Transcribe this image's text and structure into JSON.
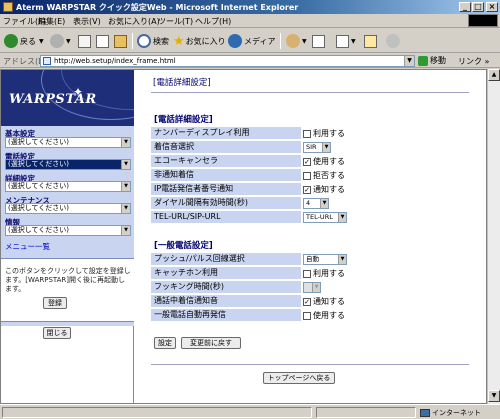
{
  "window": {
    "title": "Aterm WARPSTAR クイック設定Web - Microsoft Internet Explorer"
  },
  "menubar": {
    "items": [
      "ファイル(F)",
      "編集(E)",
      "表示(V)",
      "お気に入り(A)",
      "ツール(T)",
      "ヘルプ(H)"
    ]
  },
  "toolbar": {
    "back_label": "戻る",
    "search_label": "検索",
    "favorites_label": "お気に入り",
    "media_label": "メディア"
  },
  "addressbar": {
    "label": "アドレス(D)",
    "url": "http://web.setup/index_frame.html",
    "go_label": "移動",
    "links_label": "リンク »"
  },
  "sidebar": {
    "logo_text": "WARPSTAR",
    "sections": [
      {
        "label": "基本設定",
        "value": "(選択してください)"
      },
      {
        "label": "電話設定",
        "value": "(選択してください)"
      },
      {
        "label": "詳細設定",
        "value": "(選択してください)"
      },
      {
        "label": "メンテナンス",
        "value": "(選択してください)"
      },
      {
        "label": "情報",
        "value": "(選択してください)"
      }
    ],
    "menu_list_label": "メニュー一覧",
    "save_note": "このボタンをクリックして設定を登録します。[WARPSTAR]開く後に再起動します。",
    "register_button": "登録",
    "close_button": "閉じる"
  },
  "main": {
    "page_title": "[電話詳細設定]",
    "section1_title": "[電話詳細設定]",
    "section1_rows": [
      {
        "label": "ナンバーディスプレイ利用",
        "type": "checkbox",
        "checked": false,
        "value": "利用する"
      },
      {
        "label": "着信音選択",
        "type": "select",
        "value": "SIR"
      },
      {
        "label": "エコーキャンセラ",
        "type": "checkbox",
        "checked": true,
        "value": "使用する"
      },
      {
        "label": "非通知着信",
        "type": "checkbox",
        "checked": false,
        "value": "拒否する"
      },
      {
        "label": "IP電話発信者番号通知",
        "type": "checkbox",
        "checked": true,
        "value": "通知する"
      },
      {
        "label": "ダイヤル間隔有効時間(秒)",
        "type": "select",
        "value": "4"
      },
      {
        "label": "TEL-URL/SIP-URL",
        "type": "select",
        "value": "TEL-URL"
      }
    ],
    "section2_title": "[一般電話設定]",
    "section2_rows": [
      {
        "label": "プッシュ/パルス回線選択",
        "type": "select",
        "value": "自動"
      },
      {
        "label": "キャッチホン利用",
        "type": "checkbox",
        "checked": false,
        "value": "利用する"
      },
      {
        "label": "フッキング時間(秒)",
        "type": "select",
        "value": "",
        "disabled": true
      },
      {
        "label": "通話中着信通知音",
        "type": "checkbox",
        "checked": true,
        "value": "通知する"
      },
      {
        "label": "一般電話自動再発信",
        "type": "checkbox",
        "checked": false,
        "value": "使用する"
      }
    ],
    "set_button": "設定",
    "revert_button": "変更前に戻す",
    "top_button": "トップページへ戻る"
  },
  "statusbar": {
    "zone": "インターネット"
  }
}
